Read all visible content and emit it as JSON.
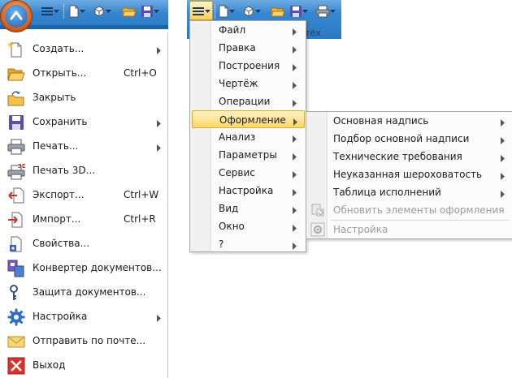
{
  "toolbar": {
    "caption_fragment": "тёх",
    "icons": [
      "menu-icon",
      "new-document-icon",
      "new-part-icon",
      "open-folder-icon",
      "save-icon",
      "print-icon"
    ]
  },
  "app_menu": {
    "items": [
      {
        "label": "Создать...",
        "shortcut": "",
        "submenu": true,
        "icon": "new-document-icon"
      },
      {
        "label": "Открыть...",
        "shortcut": "Ctrl+O",
        "submenu": false,
        "icon": "open-folder-icon"
      },
      {
        "label": "Закрыть",
        "shortcut": "",
        "submenu": false,
        "icon": "close-document-icon"
      },
      {
        "label": "Сохранить",
        "shortcut": "",
        "submenu": true,
        "icon": "save-icon"
      },
      {
        "label": "Печать...",
        "shortcut": "",
        "submenu": true,
        "icon": "print-icon"
      },
      {
        "label": "Печать 3D...",
        "shortcut": "",
        "submenu": false,
        "icon": "print-3d-icon",
        "badge": "3D"
      },
      {
        "label": "Экспорт...",
        "shortcut": "Ctrl+W",
        "submenu": false,
        "icon": "export-icon"
      },
      {
        "label": "Импорт...",
        "shortcut": "Ctrl+R",
        "submenu": false,
        "icon": "import-icon"
      },
      {
        "label": "Свойства...",
        "shortcut": "",
        "submenu": false,
        "icon": "properties-icon"
      },
      {
        "label": "Конвертер документов...",
        "shortcut": "",
        "submenu": false,
        "icon": "converter-icon"
      },
      {
        "label": "Защита документов...",
        "shortcut": "",
        "submenu": false,
        "icon": "key-icon"
      },
      {
        "label": "Настройка",
        "shortcut": "",
        "submenu": true,
        "icon": "gear-icon"
      },
      {
        "label": "Отправить по почте...",
        "shortcut": "",
        "submenu": false,
        "icon": "mail-icon"
      },
      {
        "label": "Выход",
        "shortcut": "",
        "submenu": false,
        "icon": "exit-icon"
      }
    ]
  },
  "main_menu": {
    "items": [
      {
        "label": "Файл",
        "active": false
      },
      {
        "label": "Правка",
        "active": false
      },
      {
        "label": "Построения",
        "active": false
      },
      {
        "label": "Чертёж",
        "active": false
      },
      {
        "label": "Операции",
        "active": false
      },
      {
        "label": "Оформление",
        "active": true
      },
      {
        "label": "Анализ",
        "active": false
      },
      {
        "label": "Параметры",
        "active": false
      },
      {
        "label": "Сервис",
        "active": false
      },
      {
        "label": "Настройка",
        "active": false
      },
      {
        "label": "Вид",
        "active": false
      },
      {
        "label": "Окно",
        "active": false
      },
      {
        "label": "?",
        "active": false
      }
    ]
  },
  "submenu": {
    "items": [
      {
        "label": "Основная надпись",
        "submenu": true,
        "disabled": false
      },
      {
        "label": "Подбор основной надписи",
        "submenu": true,
        "disabled": false
      },
      {
        "label": "Технические требования",
        "submenu": true,
        "disabled": false
      },
      {
        "label": "Неуказанная шероховатость",
        "submenu": true,
        "disabled": false
      },
      {
        "label": "Таблица исполнений",
        "submenu": true,
        "disabled": false
      },
      {
        "label": "Обновить элементы оформления",
        "submenu": false,
        "disabled": true,
        "icon": "refresh-elements-icon"
      },
      {
        "label": "Настройка",
        "submenu": false,
        "disabled": true,
        "icon": "settings-icon"
      }
    ]
  },
  "colors": {
    "toolbar_blue": "#2b79c4",
    "highlight_from": "#fff3c4",
    "highlight_to": "#ffd66a",
    "disabled_text": "#9c9c9c"
  }
}
